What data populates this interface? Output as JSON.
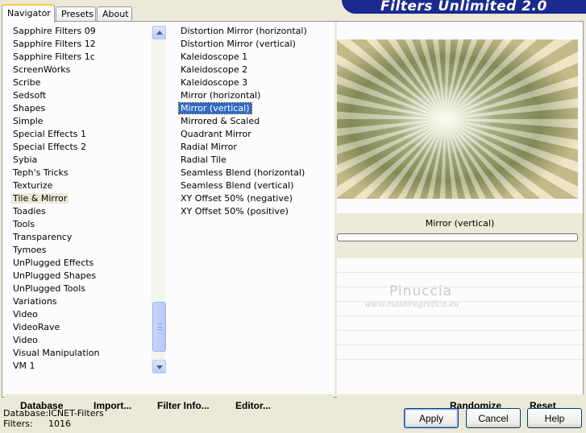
{
  "tabs": [
    {
      "label": "Navigator",
      "active": true
    },
    {
      "label": "Presets",
      "active": false
    },
    {
      "label": "About",
      "active": false
    }
  ],
  "banner_title": "Filters Unlimited 2.0",
  "categories": [
    "Sapphire Filters 09",
    "Sapphire Filters 12",
    "Sapphire Filters 1c",
    "ScreenWorks",
    "Scribe",
    "Sedsoft",
    "Shapes",
    "Simple",
    "Special Effects 1",
    "Special Effects 2",
    "Sybia",
    "Teph's Tricks",
    "Texturize",
    "Tile & Mirror",
    "Toadies",
    "Tools",
    "Transparency",
    "Tymoes",
    "UnPlugged Effects",
    "UnPlugged Shapes",
    "UnPlugged Tools",
    "Variations",
    "Video",
    "VideoRave",
    "Video",
    "Visual Manipulation",
    "VM 1"
  ],
  "selected_category": "Tile & Mirror",
  "filters": [
    "Distortion Mirror (horizontal)",
    "Distortion Mirror (vertical)",
    "Kaleidoscope 1",
    "Kaleidoscope 2",
    "Kaleidoscope 3",
    "Mirror (horizontal)",
    "Mirror (vertical)",
    "Mirrored & Scaled",
    "Quadrant Mirror",
    "Radial Mirror",
    "Radial Tile",
    "Seamless Blend (horizontal)",
    "Seamless Blend (vertical)",
    "XY Offset 50% (negative)",
    "XY Offset 50% (positive)"
  ],
  "selected_filter": "Mirror (vertical)",
  "preview_label": "Mirror (vertical)",
  "watermark": {
    "name": "Pinuccia",
    "url": "www.maidiregrafica.eu"
  },
  "left_buttons": {
    "database": "Database",
    "import": "Import...",
    "filter_info": "Filter Info...",
    "editor": "Editor..."
  },
  "right_buttons": {
    "randomize": "Randomize",
    "reset": "Reset"
  },
  "status": {
    "database_label": "Database:",
    "database_value": "ICNET-Filters",
    "filters_label": "Filters:",
    "filters_value": "1016"
  },
  "dialog_buttons": {
    "apply": "Apply",
    "cancel": "Cancel",
    "help": "Help"
  },
  "colors": {
    "selection": "#316ac5",
    "banner": "#1a2a8f",
    "background": "#ece9d8"
  }
}
